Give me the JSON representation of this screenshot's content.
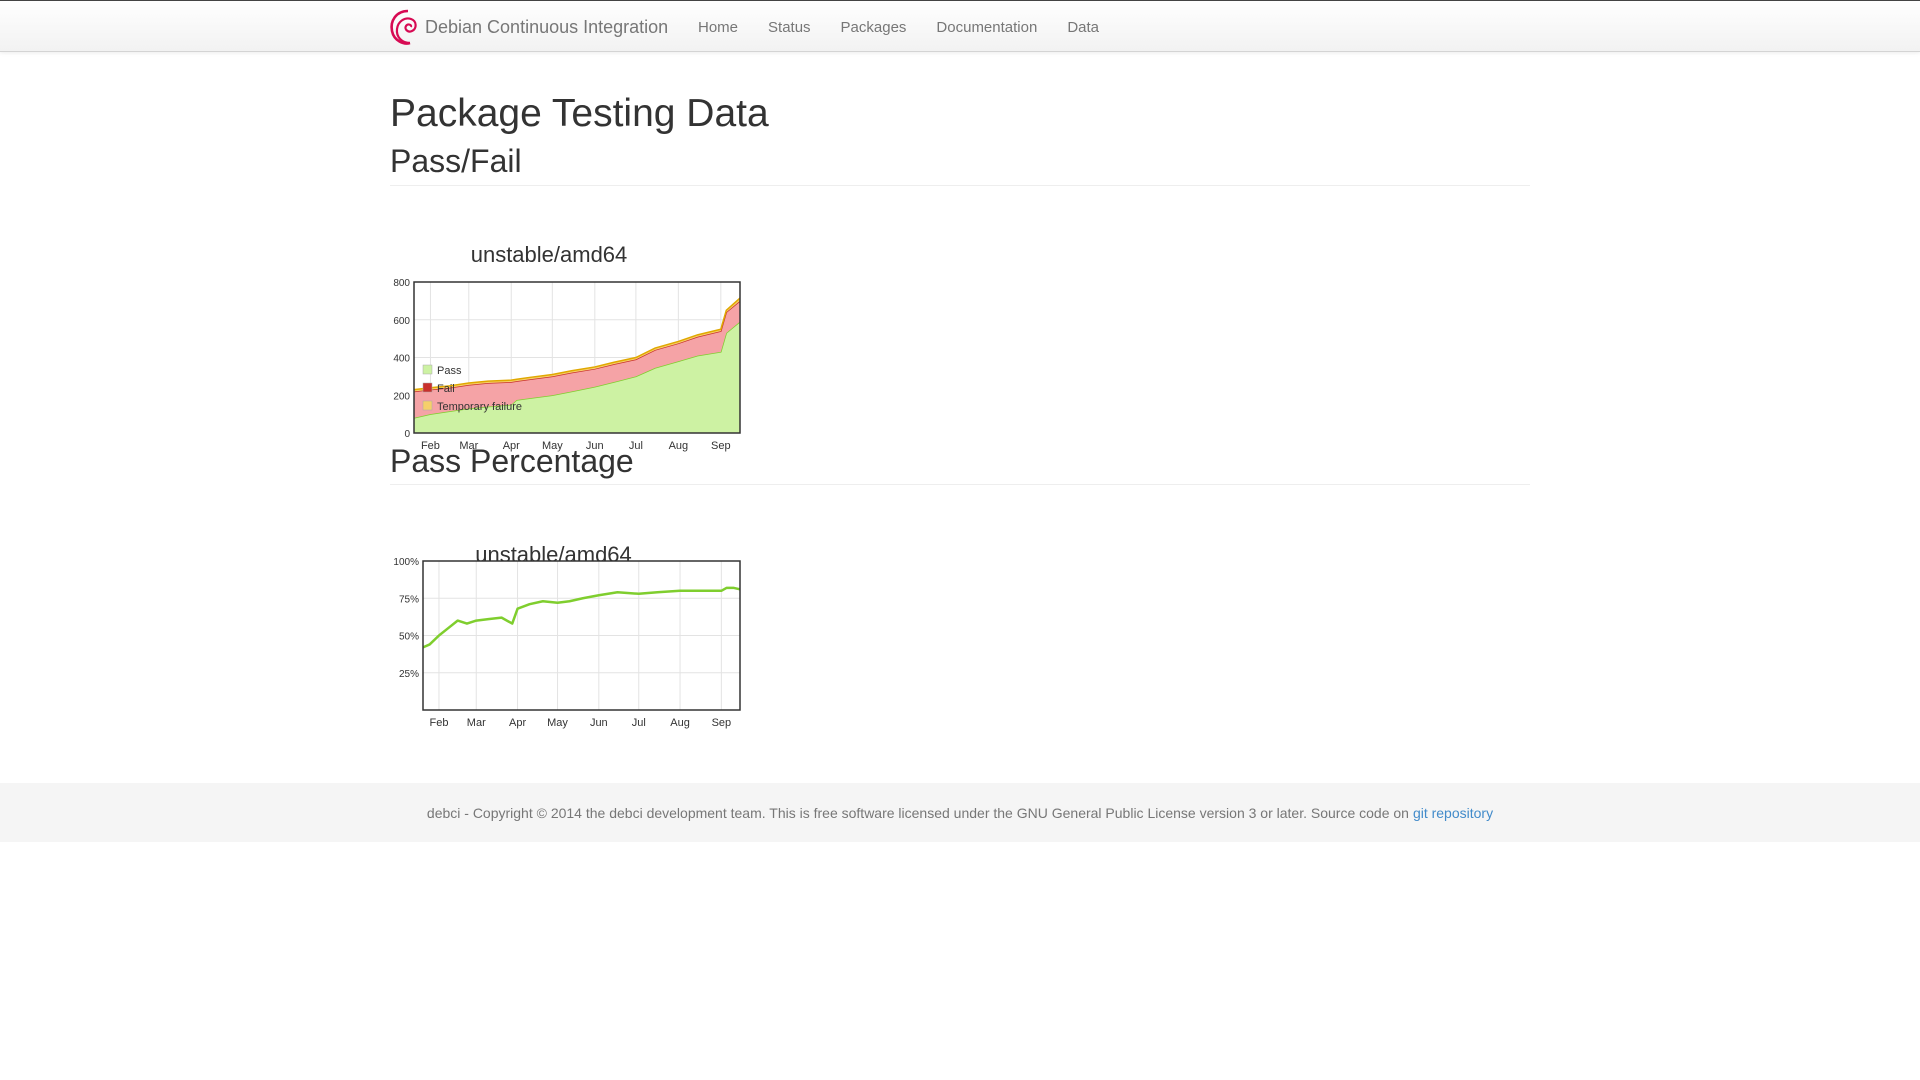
{
  "navbar": {
    "brand": "Debian Continuous Integration",
    "links": [
      "Home",
      "Status",
      "Packages",
      "Documentation",
      "Data"
    ]
  },
  "page": {
    "title": "Package Testing Data",
    "section1": "Pass/Fail",
    "section2": "Pass Percentage"
  },
  "footer": {
    "text": "debci - Copyright © 2014 the debci development team. This is free software licensed under the GNU General Public License version 3 or later. Source code on",
    "link": "git repository"
  },
  "colors": {
    "pass": "#cdf2a3",
    "pass_line": "#7fce2e",
    "fail": "#f5a3a6",
    "fail_line": "#c9302c",
    "tmpfail": "#f6cf6a",
    "link": "#428bca"
  },
  "chart_data": [
    {
      "type": "area",
      "title": "unstable/amd64",
      "stacked": true,
      "x": [
        "Jan 20",
        "Feb 1",
        "Feb 15",
        "Mar 1",
        "Mar 15",
        "Apr 1",
        "Apr 5",
        "Apr 15",
        "May 1",
        "May 15",
        "Jun 1",
        "Jun 15",
        "Jul 1",
        "Jul 15",
        "Aug 1",
        "Aug 15",
        "Sep 1",
        "Sep 5",
        "Sep 15"
      ],
      "x_ticks": [
        "Feb",
        "Mar",
        "Apr",
        "May",
        "Jun",
        "Jul",
        "Aug",
        "Sep"
      ],
      "series": [
        {
          "name": "Pass",
          "values": [
            80,
            100,
            115,
            130,
            140,
            150,
            175,
            185,
            200,
            220,
            245,
            270,
            300,
            345,
            380,
            410,
            430,
            530,
            590
          ]
        },
        {
          "name": "Fail",
          "values": [
            140,
            130,
            125,
            125,
            125,
            120,
            100,
            100,
            100,
            100,
            95,
            95,
            90,
            95,
            95,
            100,
            110,
            110,
            110
          ]
        },
        {
          "name": "Temporary failure",
          "values": [
            10,
            10,
            10,
            10,
            10,
            10,
            10,
            10,
            10,
            10,
            10,
            10,
            10,
            10,
            10,
            10,
            10,
            10,
            15
          ]
        }
      ],
      "ylim": [
        0,
        800
      ],
      "y_ticks": [
        0,
        200,
        400,
        600,
        800
      ],
      "legend": "bottom-left",
      "grid": true
    },
    {
      "type": "line",
      "title": "unstable/amd64",
      "x": [
        "Jan 20",
        "Jan 25",
        "Feb 1",
        "Feb 8",
        "Feb 15",
        "Feb 22",
        "Mar 1",
        "Mar 10",
        "Mar 20",
        "Mar 28",
        "Apr 1",
        "Apr 10",
        "Apr 20",
        "May 1",
        "May 10",
        "May 20",
        "Jun 1",
        "Jun 15",
        "Jul 1",
        "Jul 15",
        "Aug 1",
        "Aug 15",
        "Aug 25",
        "Sep 1",
        "Sep 5",
        "Sep 10",
        "Sep 15"
      ],
      "x_ticks": [
        "Feb",
        "Mar",
        "Apr",
        "May",
        "Jun",
        "Jul",
        "Aug",
        "Sep"
      ],
      "series": [
        {
          "name": "",
          "values": [
            42,
            44,
            50,
            55,
            60,
            58,
            60,
            61,
            62,
            58,
            68,
            71,
            73,
            72,
            73,
            75,
            77,
            79,
            78,
            79,
            80,
            80,
            80,
            80,
            82,
            82,
            81
          ]
        }
      ],
      "ylim": [
        0,
        100
      ],
      "y_ticks": [
        "25%",
        "50%",
        "75%",
        "100%"
      ],
      "grid": true
    }
  ]
}
